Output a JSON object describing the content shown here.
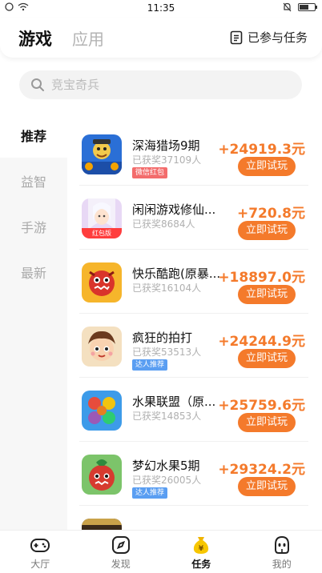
{
  "status_bar": {
    "time": "11:35",
    "battery_level": 0.6
  },
  "header": {
    "tabs": [
      {
        "label": "游戏",
        "active": true
      },
      {
        "label": "应用",
        "active": false
      }
    ],
    "joined_tasks": "已参与任务"
  },
  "search": {
    "placeholder": "竞宝奇兵"
  },
  "side_nav": {
    "items": [
      "推荐",
      "益智",
      "手游",
      "最新"
    ],
    "active_index": 0
  },
  "games": [
    {
      "title": "深海猎场9期",
      "sub": "已获奖37109人",
      "badge": "微信红包",
      "badge_color": "red",
      "reward": "+24919.3元",
      "button": "立即试玩"
    },
    {
      "title": "闲闲游戏修仙...",
      "sub": "已获奖8684人",
      "badge": "",
      "badge_color": "",
      "reward": "+720.8元",
      "button": "立即试玩",
      "thumb_tag": "红包版"
    },
    {
      "title": "快乐酷跑(原暴...",
      "sub": "已获奖16104人",
      "badge": "",
      "badge_color": "",
      "reward": "+18897.0元",
      "button": "立即试玩"
    },
    {
      "title": "疯狂的拍打",
      "sub": "已获奖53513人",
      "badge": "达人推荐",
      "badge_color": "blue",
      "reward": "+24244.9元",
      "button": "立即试玩"
    },
    {
      "title": "水果联盟（原...",
      "sub": "已获奖14853人",
      "badge": "",
      "badge_color": "",
      "reward": "+25759.6元",
      "button": "立即试玩"
    },
    {
      "title": "梦幻水果5期",
      "sub": "已获奖26005人",
      "badge": "达人推荐",
      "badge_color": "blue",
      "reward": "+29324.2元",
      "button": "立即试玩"
    }
  ],
  "bottom_nav": [
    {
      "label": "大厅",
      "icon": "gamepad-icon",
      "active": false
    },
    {
      "label": "发现",
      "icon": "compass-icon",
      "active": false
    },
    {
      "label": "任务",
      "icon": "money-bag-icon",
      "active": true
    },
    {
      "label": "我的",
      "icon": "profile-face-icon",
      "active": false
    }
  ],
  "colors": {
    "accent": "#f47a2b",
    "tab_underline": "#f8d742",
    "badge_red": "#f36c6c",
    "badge_blue": "#5a9ef2"
  }
}
